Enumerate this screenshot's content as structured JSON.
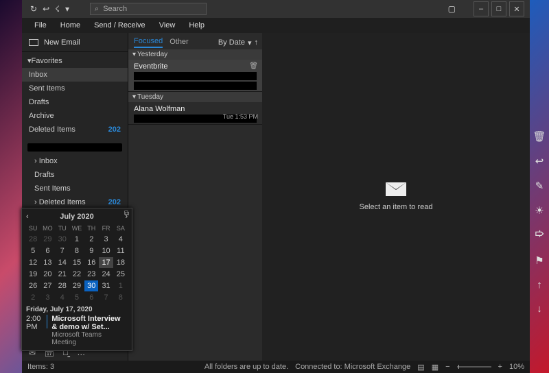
{
  "titlebar": {
    "search_placeholder": "Search"
  },
  "menu": [
    "File",
    "Home",
    "Send / Receive",
    "View",
    "Help"
  ],
  "sidebar": {
    "new_email_label": "New Email",
    "favorites_label": "Favorites",
    "favorites": [
      {
        "label": "Inbox",
        "count": "",
        "selected": true
      },
      {
        "label": "Sent Items",
        "count": ""
      },
      {
        "label": "Drafts",
        "count": ""
      },
      {
        "label": "Archive",
        "count": ""
      },
      {
        "label": "Deleted Items",
        "count": "202"
      }
    ],
    "account_folders": [
      {
        "label": "Inbox",
        "count": "",
        "expandable": true
      },
      {
        "label": "Drafts",
        "count": ""
      },
      {
        "label": "Sent Items",
        "count": ""
      },
      {
        "label": "Deleted Items",
        "count": "202",
        "expandable": true
      }
    ]
  },
  "msglist": {
    "tabs": {
      "focused": "Focused",
      "other": "Other"
    },
    "sort_label": "By Date",
    "groups": [
      {
        "header": "Yesterday",
        "items": [
          {
            "from": "Eventbrite",
            "time": "",
            "pinned": true,
            "selected": true
          }
        ]
      },
      {
        "header": "Tuesday",
        "items": [
          {
            "from": "Alana Wolfman",
            "time": "Tue 1:53 PM",
            "pinned": false
          }
        ]
      }
    ]
  },
  "reading": {
    "empty_text": "Select an item to read"
  },
  "status": {
    "items_label": "Items: 3",
    "folders_label": "All folders are up to date.",
    "connected_label": "Connected to: Microsoft Exchange",
    "zoom": "10%"
  },
  "calendar": {
    "title": "July 2020",
    "dow": [
      "SU",
      "MO",
      "TU",
      "WE",
      "TH",
      "FR",
      "SA"
    ],
    "cells": [
      {
        "d": "28",
        "o": true
      },
      {
        "d": "29",
        "o": true
      },
      {
        "d": "30",
        "o": true
      },
      {
        "d": "1"
      },
      {
        "d": "2"
      },
      {
        "d": "3"
      },
      {
        "d": "4"
      },
      {
        "d": "5"
      },
      {
        "d": "6"
      },
      {
        "d": "7"
      },
      {
        "d": "8"
      },
      {
        "d": "9"
      },
      {
        "d": "10"
      },
      {
        "d": "11"
      },
      {
        "d": "12"
      },
      {
        "d": "13"
      },
      {
        "d": "14"
      },
      {
        "d": "15"
      },
      {
        "d": "16"
      },
      {
        "d": "17",
        "hover": true
      },
      {
        "d": "18"
      },
      {
        "d": "19"
      },
      {
        "d": "20"
      },
      {
        "d": "21"
      },
      {
        "d": "22"
      },
      {
        "d": "23"
      },
      {
        "d": "24"
      },
      {
        "d": "25"
      },
      {
        "d": "26"
      },
      {
        "d": "27"
      },
      {
        "d": "28"
      },
      {
        "d": "29"
      },
      {
        "d": "30",
        "today": true
      },
      {
        "d": "31"
      },
      {
        "d": "1",
        "o": true
      },
      {
        "d": "2",
        "o": true
      },
      {
        "d": "3",
        "o": true
      },
      {
        "d": "4",
        "o": true
      },
      {
        "d": "5",
        "o": true
      },
      {
        "d": "6",
        "o": true
      },
      {
        "d": "7",
        "o": true
      },
      {
        "d": "8",
        "o": true
      }
    ],
    "selected_date": "Friday, July 17, 2020",
    "event_time": "2:00 PM",
    "event_title": "Microsoft Interview & demo w/ Set...",
    "event_sub": "Microsoft Teams Meeting"
  }
}
